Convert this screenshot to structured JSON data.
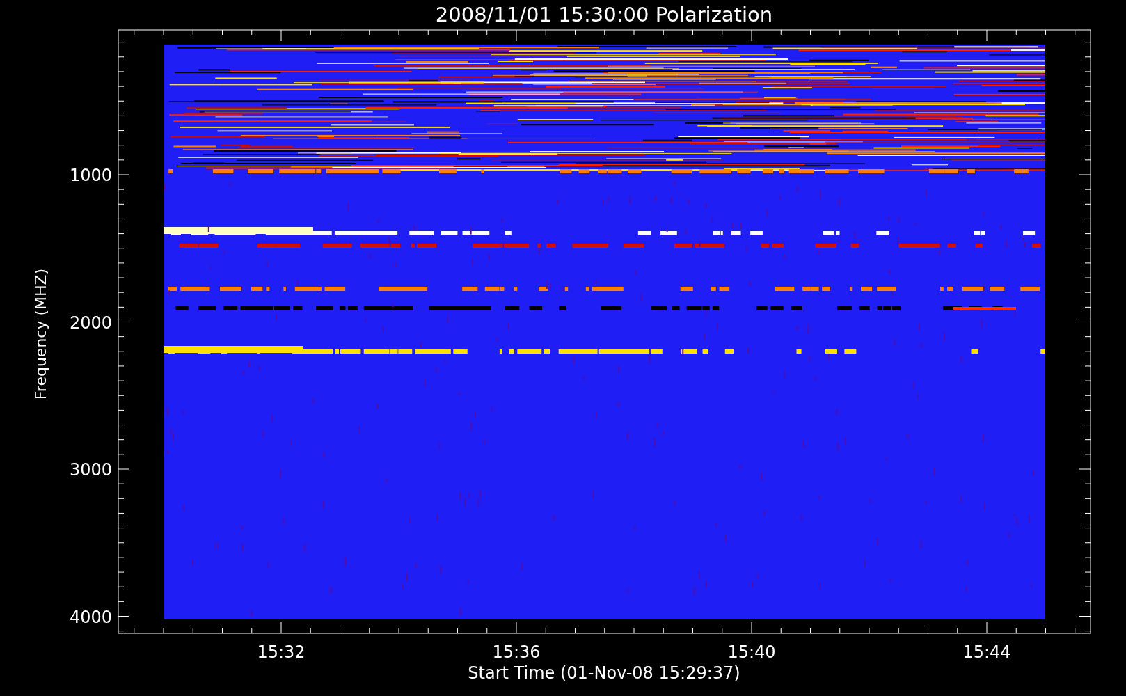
{
  "title": "2008/11/01 15:30:00 Polarization",
  "x_axis": {
    "label": "Start Time (01-Nov-08 15:29:37)",
    "ticks": [
      "15:32",
      "15:36",
      "15:40",
      "15:44"
    ]
  },
  "y_axis": {
    "label": "Frequency (MHZ)",
    "ticks": [
      "1000",
      "2000",
      "3000",
      "4000"
    ]
  }
}
